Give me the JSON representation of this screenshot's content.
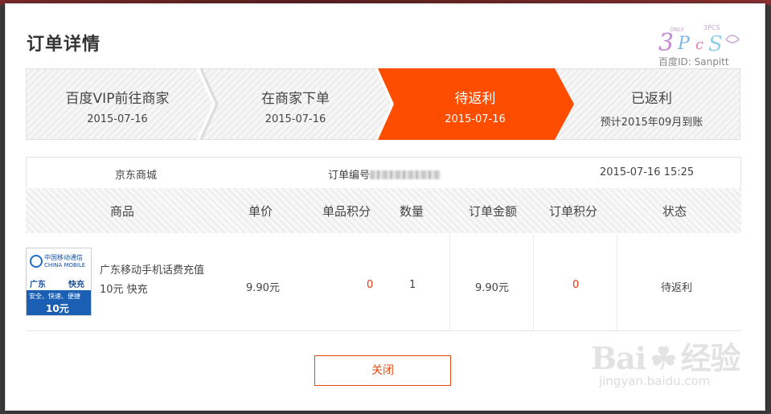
{
  "dialog": {
    "title": "订单详情",
    "close_label": "关闭"
  },
  "steps": [
    {
      "name": "百度VIP前往商家",
      "date": "2015-07-16",
      "active": false
    },
    {
      "name": "在商家下单",
      "date": "2015-07-16",
      "active": false
    },
    {
      "name": "待返利",
      "date": "2015-07-16",
      "active": true
    },
    {
      "name": "已返利",
      "date": "预计2015年09月到账",
      "active": false
    }
  ],
  "order": {
    "merchant": "京东商城",
    "number_label": "订单编号",
    "datetime": "2015-07-16 15:25"
  },
  "table": {
    "headers": [
      "商品",
      "单价",
      "单品积分",
      "数量",
      "订单金额",
      "订单积分",
      "状态"
    ],
    "row": {
      "product_name": "广东移动手机话费充值10元 快充",
      "unit_price": "9.90元",
      "item_points": "0",
      "quantity": "1",
      "order_amount": "9.90元",
      "order_points": "0",
      "status": "待返利",
      "thumb": {
        "brand_cn": "中国移动通信",
        "brand_en": "CHINA MOBILE",
        "region": "广东",
        "speed": "快充",
        "slogan": "安全、快速、便捷",
        "amount": "10元"
      }
    }
  },
  "watermarks": {
    "logo_text": "3PCS",
    "logo_id": "百度ID: Sanpitt",
    "baidu": "Bai",
    "baidu_cn": "经验",
    "baidu_url": "jingyan.baidu.com"
  },
  "colors": {
    "accent": "#ff4d00",
    "red_value": "#e8380d",
    "button_border": "#e8490f"
  }
}
